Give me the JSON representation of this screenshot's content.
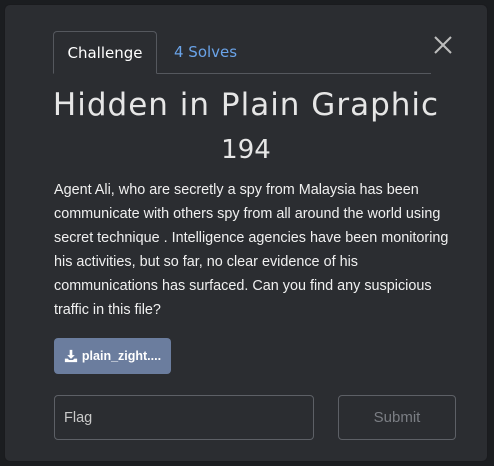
{
  "tabs": {
    "challenge_label": "Challenge",
    "solves_label": "4 Solves"
  },
  "challenge": {
    "title": "Hidden in Plain Graphic",
    "points": "194",
    "description": "Agent Ali, who are secretly a spy from Malaysia has been communicate with others spy from all around the world using secret technique . Intelligence agencies have been monitoring his activities, but so far, no clear evidence of his communications has surfaced. Can you find any suspicious traffic in this file?",
    "file_label": "plain_zight...."
  },
  "form": {
    "flag_placeholder": "Flag",
    "submit_label": "Submit"
  },
  "colors": {
    "background": "#2b2d31",
    "accent_link": "#6aa3e8",
    "download_button": "#6b7d9e"
  }
}
